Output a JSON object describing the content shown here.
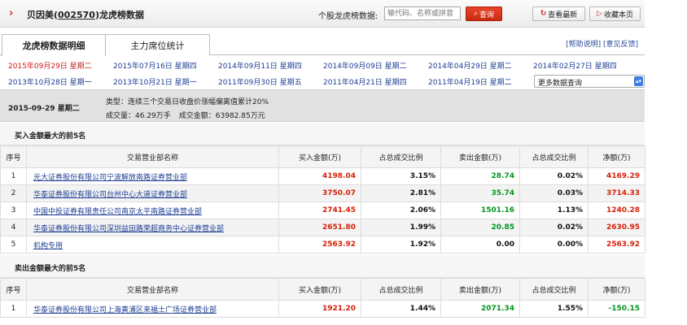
{
  "header": {
    "title_prefix": "贝因美(",
    "title_code": "002570",
    "title_suffix": ")龙虎榜数据",
    "lookup_label": "个股龙虎榜数据:",
    "lookup_placeholder": "输代码、名称或拼音",
    "query_label": "查询",
    "latest_label": "查看最新",
    "favorite_label": "收藏本页"
  },
  "tabs": [
    {
      "label": "龙虎榜数据明细",
      "active": true
    },
    {
      "label": "主力席位统计",
      "active": false
    }
  ],
  "help": {
    "help_label": "[帮助说明]",
    "feedback_label": "[意见反馈]"
  },
  "dates": {
    "row1": [
      "2015年09月29日 星期二",
      "2015年07月16日 星期四",
      "2014年09月11日 星期四",
      "2014年09月09日 星期二",
      "2014年04月29日 星期二",
      "2014年02月27日 星期四"
    ],
    "row2": [
      "2013年10月28日 星期一",
      "2013年10月21日 星期一",
      "2011年09月30日 星期五",
      "2011年04月21日 星期四",
      "2011年04月19日 星期二"
    ],
    "current": "2015年09月29日 星期二",
    "more_label": "更多数据查询"
  },
  "info": {
    "date": "2015-09-29 星期二",
    "type": "类型：连续三个交易日收盘价涨幅偏离值累计20%",
    "volume": "成交量：46.29万手",
    "amount": "成交金额：63982.85万元"
  },
  "columns": [
    "序号",
    "交易营业部名称",
    "买入金额(万)",
    "占总成交比例",
    "卖出金额(万)",
    "占总成交比例",
    "净额(万)"
  ],
  "buy": {
    "title": "买入金额最大的前5名",
    "rows": [
      {
        "no": "1",
        "name": "光大证券股份有限公司宁波解放南路证券营业部",
        "buy": "4198.04",
        "buy_pct": "3.15%",
        "sell": "28.74",
        "sell_pct": "0.02%",
        "net": "4169.29"
      },
      {
        "no": "2",
        "name": "华泰证券股份有限公司台州中心大道证券营业部",
        "buy": "3750.07",
        "buy_pct": "2.81%",
        "sell": "35.74",
        "sell_pct": "0.03%",
        "net": "3714.33"
      },
      {
        "no": "3",
        "name": "中国中投证券有限责任公司南京太平南路证券营业部",
        "buy": "2741.45",
        "buy_pct": "2.06%",
        "sell": "1501.16",
        "sell_pct": "1.13%",
        "net": "1240.28"
      },
      {
        "no": "4",
        "name": "华泰证券股份有限公司深圳益田路荣超商务中心证券营业部",
        "buy": "2651.80",
        "buy_pct": "1.99%",
        "sell": "20.85",
        "sell_pct": "0.02%",
        "net": "2630.95"
      },
      {
        "no": "5",
        "name": "机构专用",
        "buy": "2563.92",
        "buy_pct": "1.92%",
        "sell": "0.00",
        "sell_pct": "0.00%",
        "net": "2563.92"
      }
    ]
  },
  "sell": {
    "title": "卖出金额最大的前5名",
    "rows": [
      {
        "no": "1",
        "name": "华泰证券股份有限公司上海黄浦区来福士广场证券营业部",
        "buy": "1921.20",
        "buy_pct": "1.44%",
        "sell": "2071.34",
        "sell_pct": "1.55%",
        "net": "-150.15"
      }
    ]
  },
  "colors": {
    "accent_red": "#d81e06",
    "positive_green": "#00941f",
    "link_blue": "#1f3e94"
  }
}
